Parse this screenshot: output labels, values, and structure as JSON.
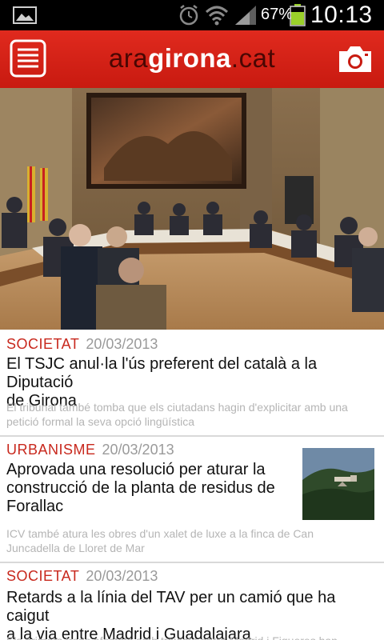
{
  "status_bar": {
    "battery_percent": "67%",
    "time": "10:13",
    "icons": [
      "gallery-icon",
      "alarm-icon",
      "wifi-icon",
      "signal-icon",
      "battery-icon"
    ]
  },
  "app_bar": {
    "brand_prefix": "ara",
    "brand_name": "girona",
    "brand_suffix": ".cat",
    "menu_icon": "menu-icon",
    "camera_icon": "camera-icon",
    "accent_color": "#d3231a"
  },
  "articles": [
    {
      "category": "SOCIETAT",
      "date": "20/03/2013",
      "headline_lines": [
        "El TSJC anul·la l'ús preferent del català a la Diputació",
        "de Girona"
      ],
      "summary_lines": [
        "El tribunal també tomba que els ciutadans hagin d'explicitar amb una",
        "petició formal la seva opció lingüística"
      ]
    },
    {
      "category": "URBANISME",
      "date": "20/03/2013",
      "headline_lines": [
        "Aprovada una resolució per aturar la",
        "construcció de la planta de residus de",
        "Forallac"
      ],
      "summary_lines": [
        "ICV també atura les obres d'un xalet de luxe a la finca de Can",
        "Juncadella de Lloret de Mar"
      ]
    },
    {
      "category": "SOCIETAT",
      "date": "20/03/2013",
      "headline_lines": [
        "Retards a la línia del TAV per un camió que ha caigut",
        "a la via entre Madrid i Guadalajara"
      ],
      "summary_lines": [
        "Els primers trens afectats amb trajecte entre Madrid i Figueres han"
      ]
    }
  ]
}
